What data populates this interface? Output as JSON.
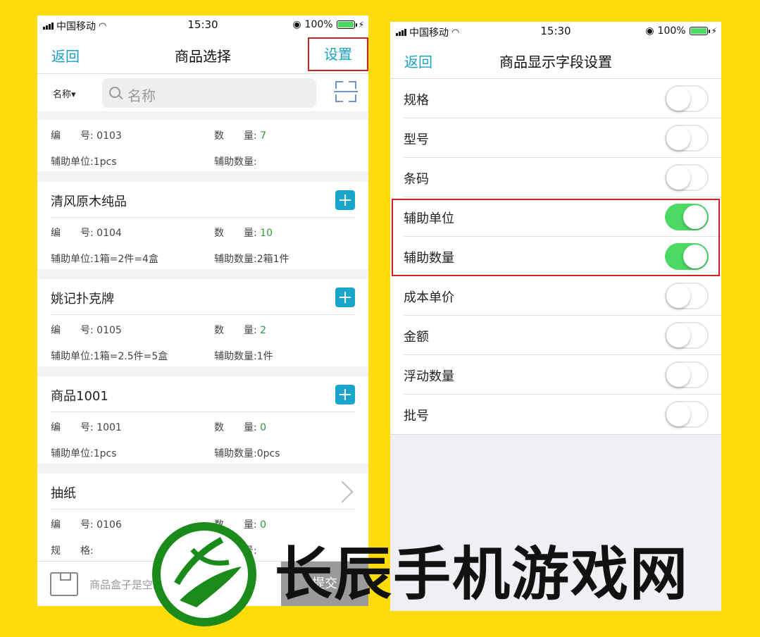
{
  "colors": {
    "background": "#fddc0a",
    "accent": "#1aa1c4",
    "highlight_border": "#d21f26",
    "switch_on": "#4cd964",
    "quantity_green": "#2f9b3a"
  },
  "left": {
    "status": {
      "carrier": "中国移动",
      "time": "15:30",
      "battery": "100%"
    },
    "nav": {
      "back": "返回",
      "title": "商品选择",
      "settings": "设置"
    },
    "search": {
      "field": "名称▾",
      "placeholder": "名称"
    },
    "items": [
      {
        "name": "",
        "code_label": "编　　号:",
        "code": "0103",
        "qty_label": "数　　量:",
        "qty": "7",
        "unit_label": "辅助单位:",
        "unit": "1pcs",
        "aux_label": "辅助数量:",
        "aux": "",
        "action": "none"
      },
      {
        "name": "清风原木纯品",
        "code_label": "编　　号:",
        "code": "0104",
        "qty_label": "数　　量:",
        "qty": "10",
        "unit_label": "辅助单位:",
        "unit": "1箱=2件=4盒",
        "aux_label": "辅助数量:",
        "aux": "2箱1件",
        "action": "add"
      },
      {
        "name": "姚记扑克牌",
        "code_label": "编　　号:",
        "code": "0105",
        "qty_label": "数　　量:",
        "qty": "2",
        "unit_label": "辅助单位:",
        "unit": "1箱=2.5件=5盒",
        "aux_label": "辅助数量:",
        "aux": "1件",
        "action": "add"
      },
      {
        "name": "商品1001",
        "code_label": "编　　号:",
        "code": "1001",
        "qty_label": "数　　量:",
        "qty": "0",
        "unit_label": "辅助单位:",
        "unit": "1pcs",
        "aux_label": "辅助数量:",
        "aux": "0pcs",
        "action": "add"
      },
      {
        "name": "抽纸",
        "code_label": "编　　号:",
        "code": "0106",
        "qty_label": "数　　量:",
        "qty": "0",
        "unit_label": "规　　格:",
        "unit": "",
        "aux_label": "型　　号:",
        "aux": "",
        "action": "chevron"
      }
    ],
    "bottom": {
      "empty_text": "商品盒子是空的",
      "submit": "提交"
    }
  },
  "right": {
    "status": {
      "carrier": "中国移动",
      "time": "15:30",
      "battery": "100%"
    },
    "nav": {
      "back": "返回",
      "title": "商品显示字段设置"
    },
    "fields": [
      {
        "label": "规格",
        "on": false
      },
      {
        "label": "型号",
        "on": false
      },
      {
        "label": "条码",
        "on": false
      },
      {
        "label": "辅助单位",
        "on": true
      },
      {
        "label": "辅助数量",
        "on": true
      },
      {
        "label": "成本单价",
        "on": false
      },
      {
        "label": "金额",
        "on": false
      },
      {
        "label": "浮动数量",
        "on": false
      },
      {
        "label": "批号",
        "on": false
      }
    ]
  },
  "watermark": {
    "text": "长辰手机游戏网"
  }
}
